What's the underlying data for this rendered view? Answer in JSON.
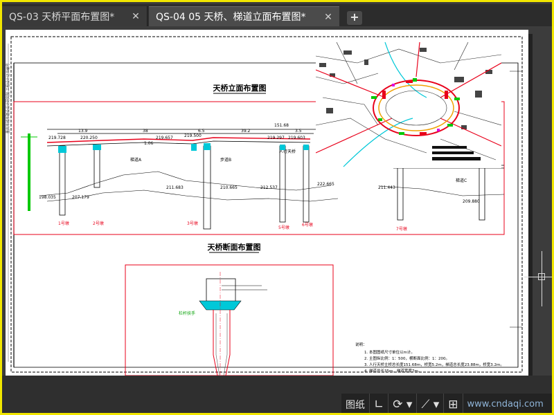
{
  "tabs": [
    {
      "label": "QS-03 天桥平面布置图*"
    },
    {
      "label": "QS-04 05 天桥、梯道立面布置图*"
    }
  ],
  "new_tab_symbol": "+",
  "close_symbol": "✕",
  "watermark": "www.cndaqi.com",
  "drawing": {
    "elevation_title": "天桥立面布置图",
    "section_title": "天桥断面布置图",
    "total_length": "151.68",
    "spans": [
      "13.9",
      "38",
      "6.5",
      "39.2",
      "3.5"
    ],
    "elevations": [
      "219.728",
      "220.250",
      "219.657",
      "219.500",
      "219.297",
      "219.603"
    ],
    "ground_levels": [
      "198.035",
      "207.179",
      "211.683",
      "210.665",
      "212.537",
      "222.665",
      "211.443",
      "209.880"
    ],
    "labels": [
      "1.06",
      "梯道A",
      "步道B",
      "人行天桥",
      "梯道C"
    ],
    "pier_labels": [
      "1号墩",
      "2号墩",
      "3号墩",
      "5号墩",
      "6号墩",
      "7号墩"
    ],
    "notes_title": "说明：",
    "notes": [
      "1. 本图图纸尺寸单位以m计。",
      "2. 主图纵比例：1：500，横断面比例：1：200。",
      "3. 人行天桥主桥总长度151.68m，桥宽5.2m，梯道总长度23.88m，桥宽3.2m。",
      "4. 梯道总长35m，梯道宽度7m。"
    ],
    "side_text": "重庆市城市建设设计研究院 工程设计证书编号"
  },
  "statusbar": {
    "layout_label": "图纸",
    "tools": [
      "ortho-icon",
      "polar-icon",
      "snap-icon",
      "osnap-icon"
    ]
  },
  "colors": {
    "accent_yellow": "#f1e600",
    "cad_red": "#e8001a",
    "cad_cyan": "#00c8d8",
    "cad_green": "#00c800"
  }
}
